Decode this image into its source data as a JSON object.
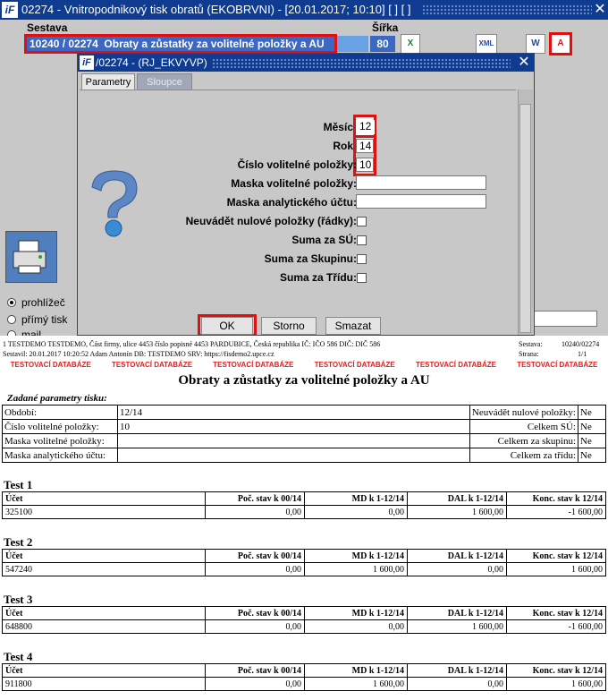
{
  "window": {
    "title": "02274 - Vnitropodnikový tisk obratů (EKOBRVNI) - [20.01.2017; 10:10]  [ ]  [ ]",
    "close_label": "✕"
  },
  "main": {
    "label_sestava": "Sestava",
    "label_sirka": "Šířka",
    "report_code": "10240 / 02274",
    "report_name": "Obraty a zůstatky za volitelné položky a AU",
    "width_value": "80",
    "radio_prohlizec": "prohlížeč",
    "radio_primy_tisk": "přímý tisk",
    "radio_mail": "mail"
  },
  "dialog": {
    "title": "/02274 - (RJ_EKVYVP)",
    "close_label": "✕",
    "tabs": {
      "parametry": "Parametry",
      "sloupce": "Sloupce"
    },
    "fields": {
      "mesic_label": "Měsíc:",
      "mesic_value": "12",
      "rok_label": "Rok:",
      "rok_value": "14",
      "cislo_label": "Číslo volitelné položky:",
      "cislo_value": "10",
      "maska_vp_label": "Maska volitelné položky:",
      "maska_au_label": "Maska analytického účtu:",
      "neuvadet_label": "Neuvádět nulové položky (řádky):",
      "suma_su_label": "Suma za SÚ:",
      "suma_skupinu_label": "Suma za Skupinu:",
      "suma_tridu_label": "Suma za Třídu:"
    },
    "buttons": {
      "ok": "OK",
      "storno": "Storno",
      "smazat": "Smazat"
    }
  },
  "report": {
    "header_line1": "1 TESTDEMO TESTDEMO, Část firmy, ulice 4453 číslo popisné 4453 PARDUBICE, Česká republika  IČ: IČO 586  DIČ: DIČ 586",
    "header_line2": "Sestavil: 20.01.2017 10:20:52 Adam Antonín  DB: TESTDEMO  SRV: https://fisdemo2.upce.cz",
    "sestava_label": "Sestava:",
    "sestava_value": "10240/02274",
    "strana_label": "Strana:",
    "strana_value": "1/1",
    "test_db_label": "TESTOVACÍ DATABÁZE",
    "title": "Obraty a zůstatky za volitelné položky a AU",
    "params_title": "Zadané parametry tisku:",
    "params": [
      {
        "label": "Období:",
        "value": "12/14",
        "rlabel": "Neuvádět nulové položky:",
        "rvalue": "Ne"
      },
      {
        "label": "Číslo volitelné položky:",
        "value": "10",
        "rlabel": "Celkem SÚ:",
        "rvalue": "Ne"
      },
      {
        "label": "Maska volitelné položky:",
        "value": "",
        "rlabel": "Celkem za skupinu:",
        "rvalue": "Ne"
      },
      {
        "label": "Maska analytického účtu:",
        "value": "",
        "rlabel": "Celkem za třídu:",
        "rvalue": "Ne"
      }
    ],
    "columns": [
      "Účet",
      "Poč. stav k 00/14",
      "MD k 1-12/14",
      "DAL k 1-12/14",
      "Konc. stav k 12/14"
    ],
    "sections": [
      {
        "title": "Test 1",
        "row": [
          "325100",
          "0,00",
          "0,00",
          "1 600,00",
          "-1 600,00"
        ]
      },
      {
        "title": "Test 2",
        "row": [
          "547240",
          "0,00",
          "1 600,00",
          "0,00",
          "1 600,00"
        ]
      },
      {
        "title": "Test 3",
        "row": [
          "648800",
          "0,00",
          "0,00",
          "1 600,00",
          "-1 600,00"
        ]
      },
      {
        "title": "Test 4",
        "row": [
          "911800",
          "0,00",
          "1 600,00",
          "0,00",
          "1 600,00"
        ]
      }
    ]
  },
  "colors": {
    "titlebar": "#0f3c91",
    "highlight": "#e01010",
    "selection": "#3a68c2",
    "test_db": "#e02020"
  }
}
